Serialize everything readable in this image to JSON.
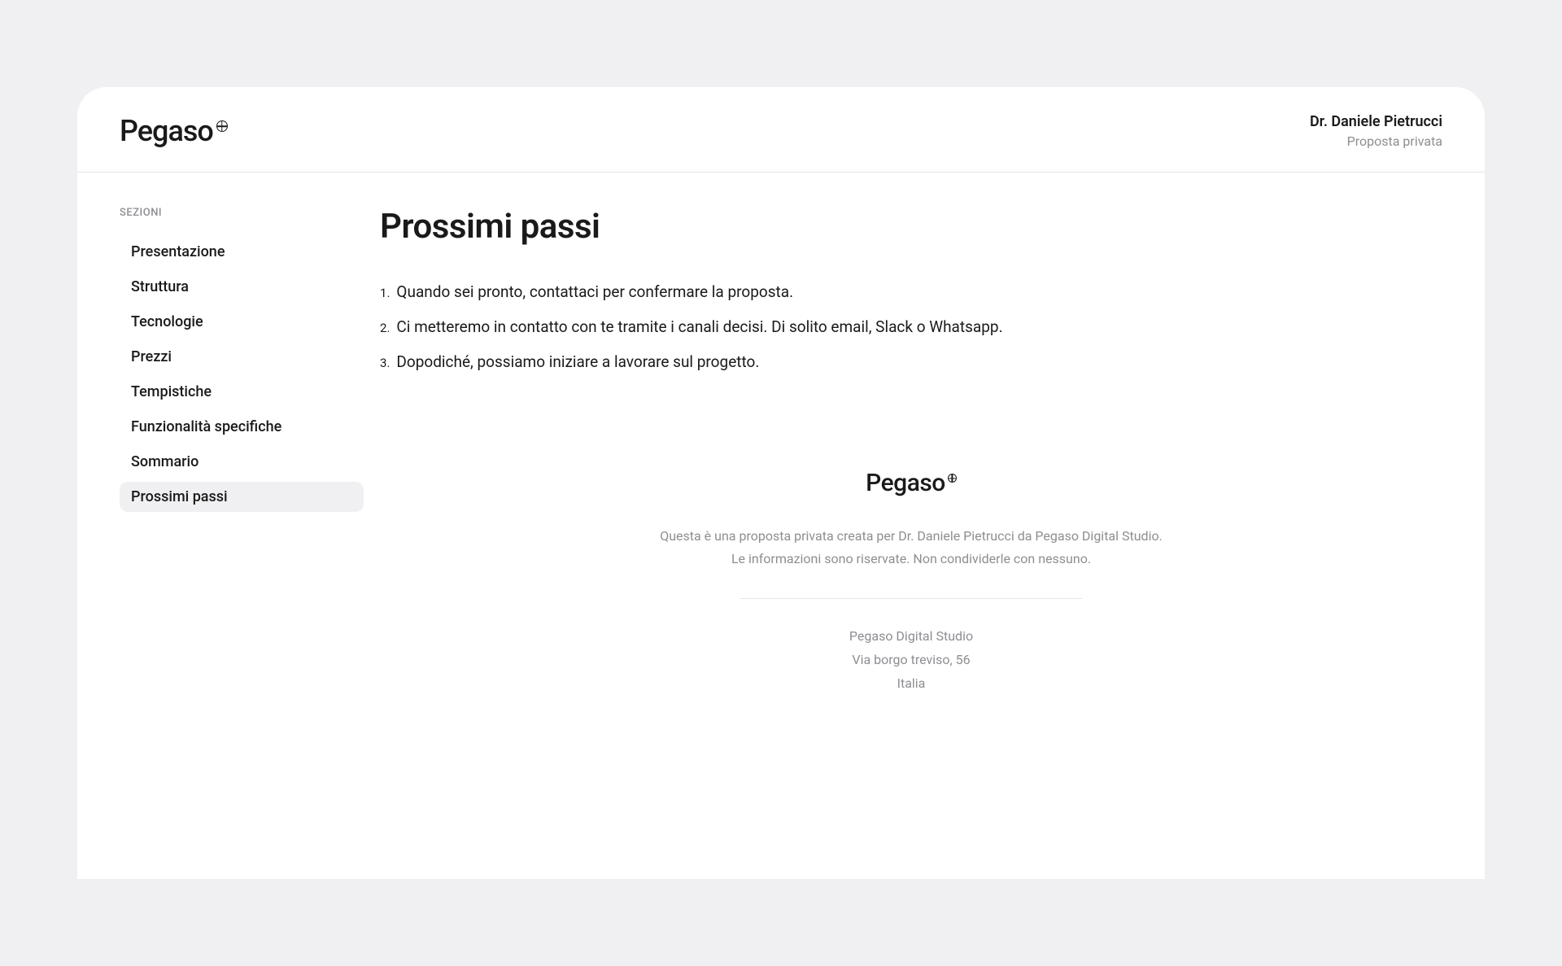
{
  "header": {
    "logo_text": "Pegaso",
    "client_name": "Dr. Daniele Pietrucci",
    "subtitle": "Proposta privata"
  },
  "sidebar": {
    "label": "SEZIONI",
    "items": [
      {
        "label": "Presentazione",
        "active": false
      },
      {
        "label": "Struttura",
        "active": false
      },
      {
        "label": "Tecnologie",
        "active": false
      },
      {
        "label": "Prezzi",
        "active": false
      },
      {
        "label": "Tempistiche",
        "active": false
      },
      {
        "label": "Funzionalità specifiche",
        "active": false
      },
      {
        "label": "Sommario",
        "active": false
      },
      {
        "label": "Prossimi passi",
        "active": true
      }
    ]
  },
  "main": {
    "title": "Prossimi passi",
    "steps": [
      "Quando sei pronto, contattaci per confermare la proposta.",
      "Ci metteremo in contatto con te tramite i canali decisi. Di solito email, Slack o Whatsapp.",
      "Dopodiché, possiamo iniziare a lavorare sul progetto."
    ]
  },
  "footer": {
    "logo_text": "Pegaso",
    "line1": "Questa è una proposta privata creata per Dr. Daniele Pietrucci da Pegaso Digital Studio.",
    "line2": "Le informazioni sono riservate. Non condividerle con nessuno.",
    "company": "Pegaso Digital Studio",
    "address": "Via borgo treviso, 56",
    "country": "Italia"
  }
}
